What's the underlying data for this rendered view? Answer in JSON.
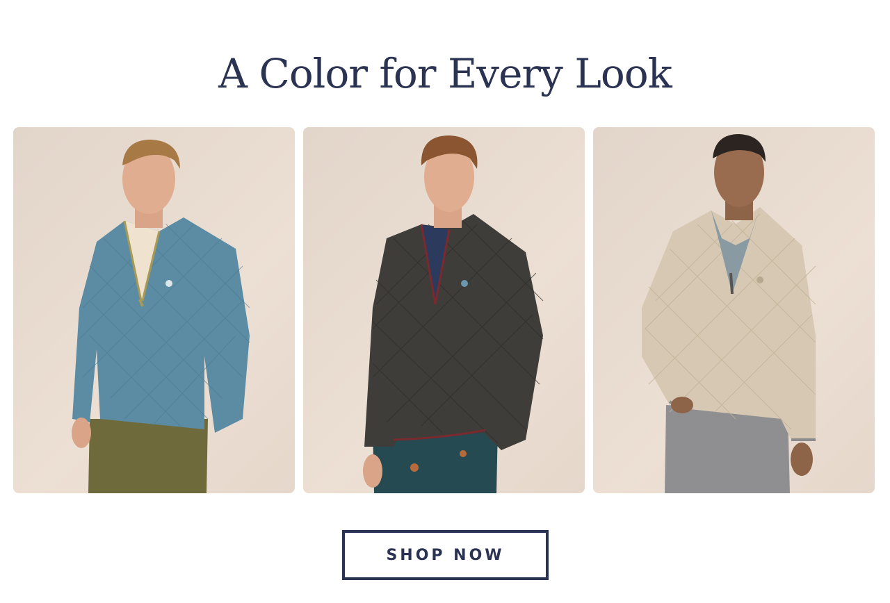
{
  "headline": "A Color for Every Look",
  "products": [
    {
      "color_name": "blue",
      "sweater_color": "#5b8ca3",
      "pants_color": "#6e6a3b",
      "trim_color": "#a89a55"
    },
    {
      "color_name": "charcoal",
      "sweater_color": "#3f3d3a",
      "pants_color": "#254a52",
      "trim_color": "#7a2a2e"
    },
    {
      "color_name": "oatmeal",
      "sweater_color": "#d6c8b2",
      "pants_color": "#8f8f92",
      "trim_color": "#8c8c8c"
    }
  ],
  "cta": {
    "label": "SHOP NOW"
  },
  "colors": {
    "brand_navy": "#2a3352",
    "background": "#ffffff"
  }
}
